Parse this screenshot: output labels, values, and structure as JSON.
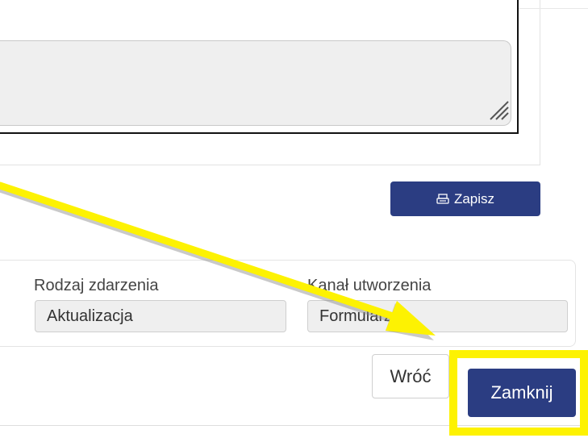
{
  "save": {
    "label": "Zapisz",
    "icon": "printer-icon"
  },
  "event_info": {
    "event_type_label": "Rodzaj zdarzenia",
    "event_type_value": "Aktualizacja",
    "creation_channel_label": "Kanał utworzenia",
    "creation_channel_value": "Formularz"
  },
  "footer": {
    "back_label": "Wróć",
    "close_label": "Zamknij"
  },
  "colors": {
    "primary_button": "#2b3d82",
    "highlight": "#fdf202",
    "field_background": "#efefef"
  }
}
